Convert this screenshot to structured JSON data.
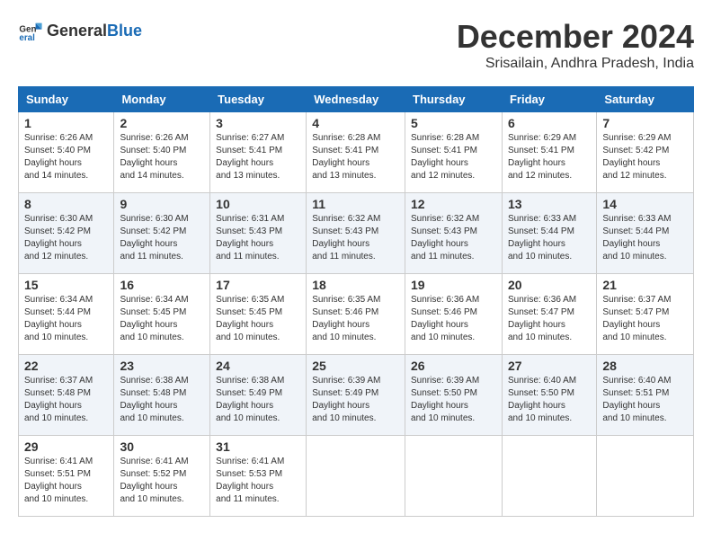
{
  "logo": {
    "text_general": "General",
    "text_blue": "Blue"
  },
  "calendar": {
    "title": "December 2024",
    "subtitle": "Srisailain, Andhra Pradesh, India",
    "headers": [
      "Sunday",
      "Monday",
      "Tuesday",
      "Wednesday",
      "Thursday",
      "Friday",
      "Saturday"
    ],
    "weeks": [
      [
        {
          "day": "1",
          "sunrise": "6:26 AM",
          "sunset": "5:40 PM",
          "daylight": "11 hours and 14 minutes."
        },
        {
          "day": "2",
          "sunrise": "6:26 AM",
          "sunset": "5:40 PM",
          "daylight": "11 hours and 14 minutes."
        },
        {
          "day": "3",
          "sunrise": "6:27 AM",
          "sunset": "5:41 PM",
          "daylight": "11 hours and 13 minutes."
        },
        {
          "day": "4",
          "sunrise": "6:28 AM",
          "sunset": "5:41 PM",
          "daylight": "11 hours and 13 minutes."
        },
        {
          "day": "5",
          "sunrise": "6:28 AM",
          "sunset": "5:41 PM",
          "daylight": "11 hours and 12 minutes."
        },
        {
          "day": "6",
          "sunrise": "6:29 AM",
          "sunset": "5:41 PM",
          "daylight": "11 hours and 12 minutes."
        },
        {
          "day": "7",
          "sunrise": "6:29 AM",
          "sunset": "5:42 PM",
          "daylight": "11 hours and 12 minutes."
        }
      ],
      [
        {
          "day": "8",
          "sunrise": "6:30 AM",
          "sunset": "5:42 PM",
          "daylight": "11 hours and 12 minutes."
        },
        {
          "day": "9",
          "sunrise": "6:30 AM",
          "sunset": "5:42 PM",
          "daylight": "11 hours and 11 minutes."
        },
        {
          "day": "10",
          "sunrise": "6:31 AM",
          "sunset": "5:43 PM",
          "daylight": "11 hours and 11 minutes."
        },
        {
          "day": "11",
          "sunrise": "6:32 AM",
          "sunset": "5:43 PM",
          "daylight": "11 hours and 11 minutes."
        },
        {
          "day": "12",
          "sunrise": "6:32 AM",
          "sunset": "5:43 PM",
          "daylight": "11 hours and 11 minutes."
        },
        {
          "day": "13",
          "sunrise": "6:33 AM",
          "sunset": "5:44 PM",
          "daylight": "11 hours and 10 minutes."
        },
        {
          "day": "14",
          "sunrise": "6:33 AM",
          "sunset": "5:44 PM",
          "daylight": "11 hours and 10 minutes."
        }
      ],
      [
        {
          "day": "15",
          "sunrise": "6:34 AM",
          "sunset": "5:44 PM",
          "daylight": "11 hours and 10 minutes."
        },
        {
          "day": "16",
          "sunrise": "6:34 AM",
          "sunset": "5:45 PM",
          "daylight": "11 hours and 10 minutes."
        },
        {
          "day": "17",
          "sunrise": "6:35 AM",
          "sunset": "5:45 PM",
          "daylight": "11 hours and 10 minutes."
        },
        {
          "day": "18",
          "sunrise": "6:35 AM",
          "sunset": "5:46 PM",
          "daylight": "11 hours and 10 minutes."
        },
        {
          "day": "19",
          "sunrise": "6:36 AM",
          "sunset": "5:46 PM",
          "daylight": "11 hours and 10 minutes."
        },
        {
          "day": "20",
          "sunrise": "6:36 AM",
          "sunset": "5:47 PM",
          "daylight": "11 hours and 10 minutes."
        },
        {
          "day": "21",
          "sunrise": "6:37 AM",
          "sunset": "5:47 PM",
          "daylight": "11 hours and 10 minutes."
        }
      ],
      [
        {
          "day": "22",
          "sunrise": "6:37 AM",
          "sunset": "5:48 PM",
          "daylight": "11 hours and 10 minutes."
        },
        {
          "day": "23",
          "sunrise": "6:38 AM",
          "sunset": "5:48 PM",
          "daylight": "11 hours and 10 minutes."
        },
        {
          "day": "24",
          "sunrise": "6:38 AM",
          "sunset": "5:49 PM",
          "daylight": "11 hours and 10 minutes."
        },
        {
          "day": "25",
          "sunrise": "6:39 AM",
          "sunset": "5:49 PM",
          "daylight": "11 hours and 10 minutes."
        },
        {
          "day": "26",
          "sunrise": "6:39 AM",
          "sunset": "5:50 PM",
          "daylight": "11 hours and 10 minutes."
        },
        {
          "day": "27",
          "sunrise": "6:40 AM",
          "sunset": "5:50 PM",
          "daylight": "11 hours and 10 minutes."
        },
        {
          "day": "28",
          "sunrise": "6:40 AM",
          "sunset": "5:51 PM",
          "daylight": "11 hours and 10 minutes."
        }
      ],
      [
        {
          "day": "29",
          "sunrise": "6:41 AM",
          "sunset": "5:51 PM",
          "daylight": "11 hours and 10 minutes."
        },
        {
          "day": "30",
          "sunrise": "6:41 AM",
          "sunset": "5:52 PM",
          "daylight": "11 hours and 10 minutes."
        },
        {
          "day": "31",
          "sunrise": "6:41 AM",
          "sunset": "5:53 PM",
          "daylight": "11 hours and 11 minutes."
        },
        null,
        null,
        null,
        null
      ]
    ]
  }
}
